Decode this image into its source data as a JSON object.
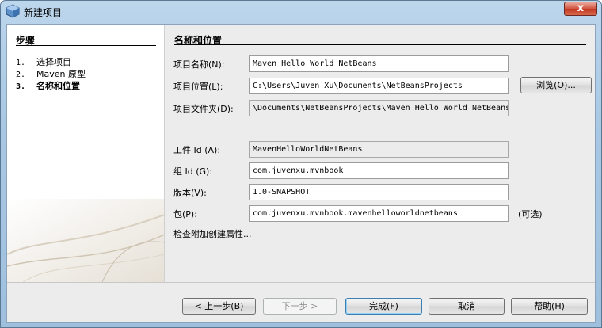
{
  "window": {
    "title": "新建项目",
    "close_label": "x",
    "icon": "netbeans-app-icon"
  },
  "steps": {
    "title": "步骤",
    "items": [
      {
        "num": "1.",
        "label": "选择项目",
        "current": false
      },
      {
        "num": "2.",
        "label": "Maven 原型",
        "current": false
      },
      {
        "num": "3.",
        "label": "名称和位置",
        "current": true
      }
    ]
  },
  "form": {
    "title": "名称和位置",
    "fields": {
      "project_name": {
        "label": "项目名称(N):",
        "value": "Maven Hello World NetBeans"
      },
      "project_location": {
        "label": "项目位置(L):",
        "value": "C:\\Users\\Juven Xu\\Documents\\NetBeansProjects"
      },
      "project_folder": {
        "label": "项目文件夹(D):",
        "value": "\\Documents\\NetBeansProjects\\Maven Hello World NetBeans"
      },
      "artifact_id": {
        "label": "工件 Id (A):",
        "value": "MavenHelloWorldNetBeans"
      },
      "group_id": {
        "label": "组 Id (G):",
        "value": "com.juvenxu.mvnbook"
      },
      "version": {
        "label": "版本(V):",
        "value": "1.0-SNAPSHOT"
      },
      "package": {
        "label": "包(P):",
        "value": "com.juvenxu.mvnbook.mavenhelloworldnetbeans"
      }
    },
    "browse_label": "浏览(O)...",
    "optional_label": "(可选)",
    "more_props_label": "检查附加创建属性..."
  },
  "buttons": {
    "back": "< 上一步(B)",
    "next": "下一步 >",
    "finish": "完成(F)",
    "cancel": "取消",
    "help": "帮助(H)"
  },
  "colors": {
    "titlebar": "#a8c7e2",
    "close_button": "#c13a23",
    "dialog_background": "#ececec",
    "default_button_accent": "#3c7fb1"
  }
}
